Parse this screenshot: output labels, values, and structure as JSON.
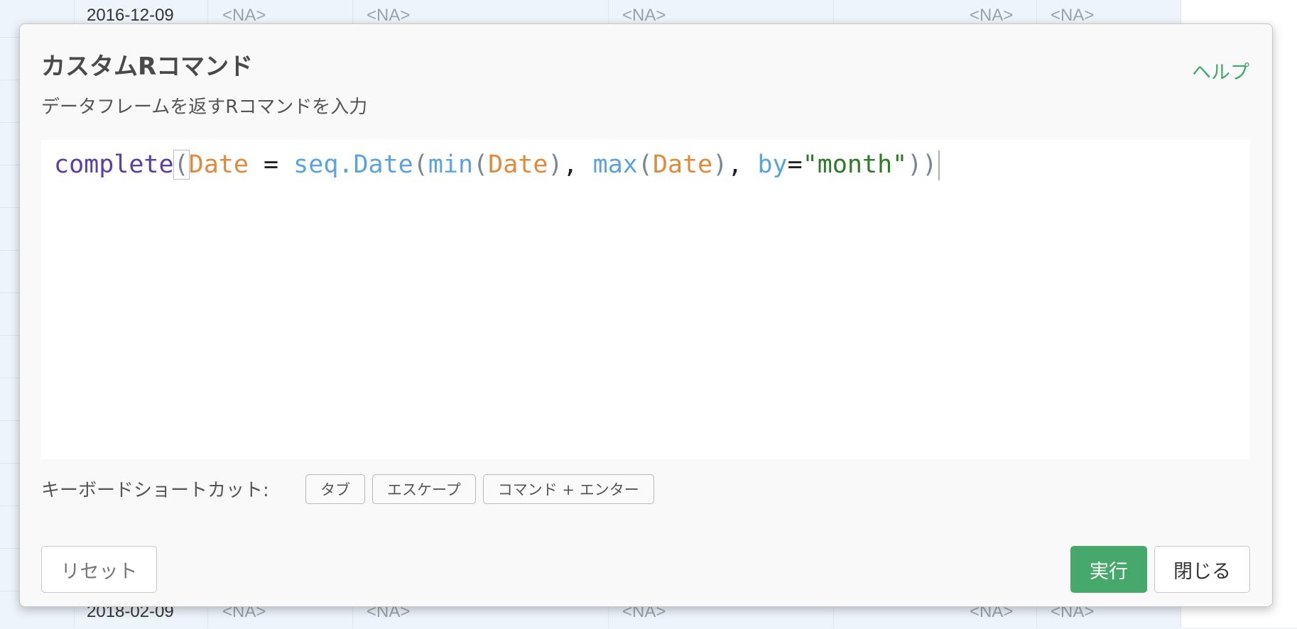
{
  "background_grid": {
    "top_row": {
      "date": "2016-12-09",
      "cells": [
        "<NA>",
        "<NA>",
        "<NA>",
        "<NA>",
        "<NA>"
      ]
    },
    "bottom_row": {
      "date": "2018-02-09",
      "cells": [
        "<NA>",
        "<NA>",
        "<NA>",
        "<NA>",
        "<NA>"
      ]
    }
  },
  "dialog": {
    "title": "カスタムRコマンド",
    "help_link": "ヘルプ",
    "subtitle": "データフレームを返すRコマンドを入力",
    "editor": {
      "code_tokens": [
        {
          "text": "complete",
          "kind": "fn"
        },
        {
          "text": "(",
          "kind": "punc"
        },
        {
          "text": "Date",
          "kind": "var"
        },
        {
          "text": " = ",
          "kind": "op"
        },
        {
          "text": "seq.Date",
          "kind": "call"
        },
        {
          "text": "(",
          "kind": "punc"
        },
        {
          "text": "min",
          "kind": "call"
        },
        {
          "text": "(",
          "kind": "punc"
        },
        {
          "text": "Date",
          "kind": "var"
        },
        {
          "text": ")",
          "kind": "punc"
        },
        {
          "text": ", ",
          "kind": "op"
        },
        {
          "text": "max",
          "kind": "call"
        },
        {
          "text": "(",
          "kind": "punc"
        },
        {
          "text": "Date",
          "kind": "var"
        },
        {
          "text": ")",
          "kind": "punc"
        },
        {
          "text": ", ",
          "kind": "op"
        },
        {
          "text": "by",
          "kind": "call"
        },
        {
          "text": "=",
          "kind": "op"
        },
        {
          "text": "\"month\"",
          "kind": "str"
        },
        {
          "text": "))",
          "kind": "punc"
        }
      ]
    },
    "shortcuts": {
      "label": "キーボードショートカット:",
      "keys": [
        "タブ",
        "エスケープ",
        "コマンド + エンター"
      ]
    },
    "buttons": {
      "reset": "リセット",
      "run": "実行",
      "close": "閉じる"
    }
  }
}
